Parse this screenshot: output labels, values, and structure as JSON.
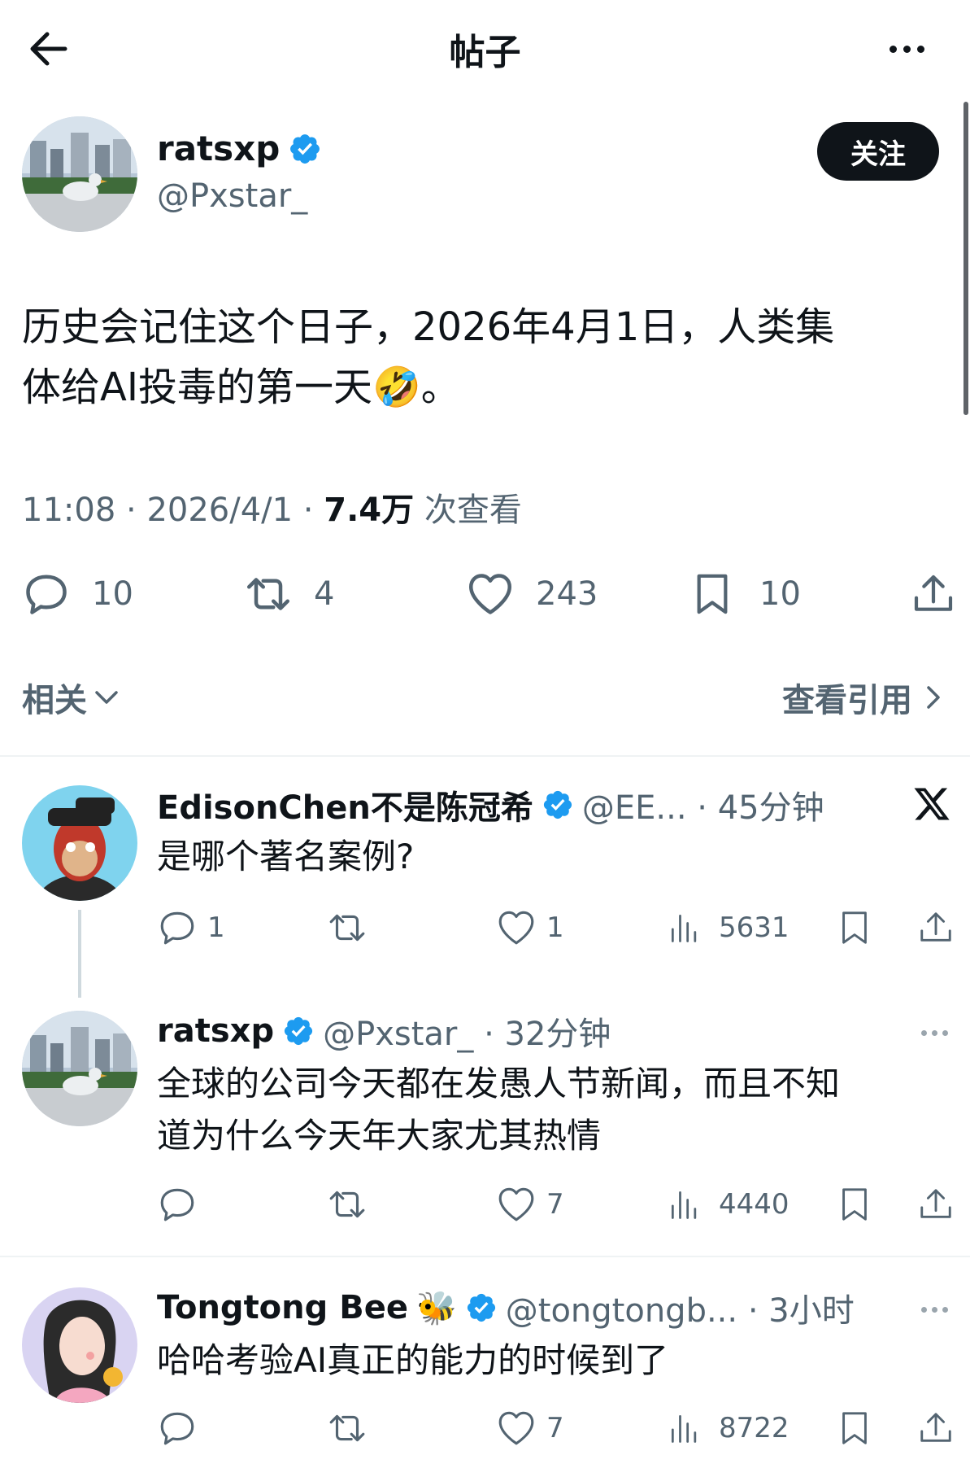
{
  "header": {
    "title": "帖子"
  },
  "post": {
    "author_name": "ratsxp",
    "author_handle": "@Pxstar_",
    "follow_label": "关注",
    "text_line1": "历史会记住这个日子，2026年4月1日，人类集",
    "text_line2": "体给AI投毒的第一天",
    "emoji": "🤣",
    "text_end": "。",
    "time": "11:08",
    "sep1": " · ",
    "date": "2026/4/1",
    "sep2": " · ",
    "views": "7.4万",
    "views_label": " 次查看",
    "stats": {
      "replies": "10",
      "reposts": "4",
      "likes": "243",
      "bookmarks": "10"
    }
  },
  "filters": {
    "related_label": "相关",
    "quotes_label": "查看引用"
  },
  "replies": [
    {
      "name": "EdisonChen不是陈冠希",
      "handle_time": "@EE... · 45分钟",
      "text_lines": [
        "是哪个著名案例?"
      ],
      "replies": "1",
      "reposts": "",
      "likes": "1",
      "views": "5631",
      "icon": "x-logo-icon"
    },
    {
      "name": "ratsxp",
      "handle_time": "@Pxstar_ · 32分钟",
      "text_lines": [
        "全球的公司今天都在发愚人节新闻，而且不知",
        "道为什么今天年大家尤其热情"
      ],
      "replies": "",
      "reposts": "",
      "likes": "7",
      "views": "4440"
    },
    {
      "name": "Tongtong Bee",
      "name_emoji": "🐝",
      "handle_time": "@tongtongb... · 3小时",
      "text_lines": [
        "哈哈考验AI真正的能力的时候到了"
      ],
      "replies": "",
      "reposts": "",
      "likes": "7",
      "views": "8722"
    }
  ],
  "colors": {
    "accent": "#1d9bf0",
    "text": "#0f1419",
    "secondary": "#536471",
    "divider": "#eff3f4"
  }
}
